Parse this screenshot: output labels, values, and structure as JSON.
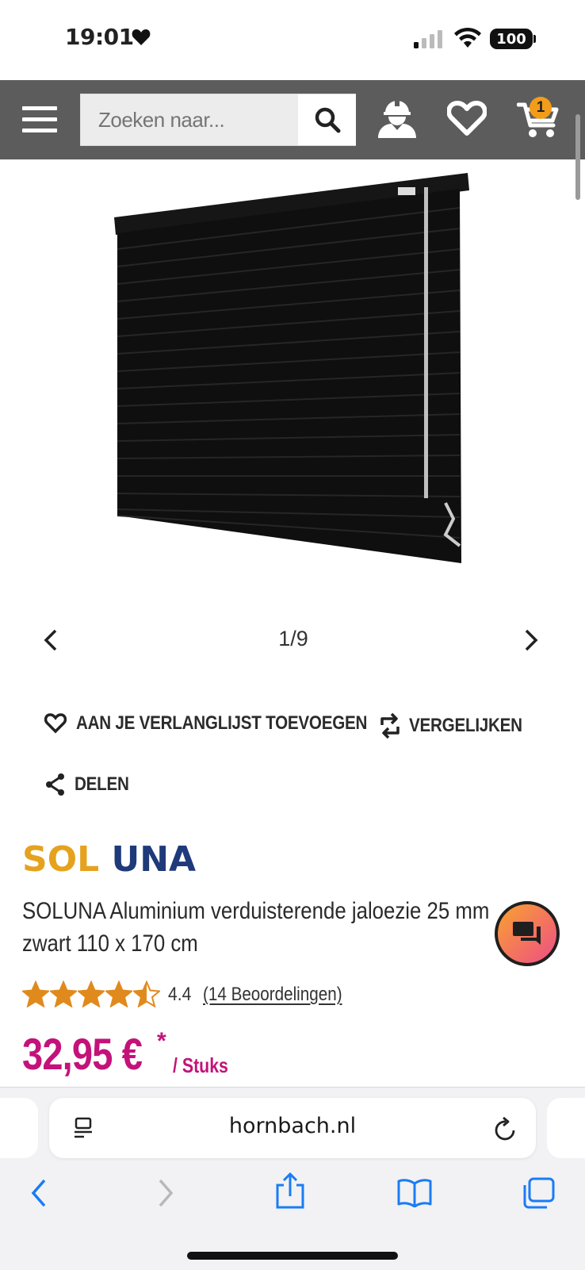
{
  "status_bar": {
    "time": "19:01",
    "battery": "100"
  },
  "header": {
    "search_placeholder": "Zoeken naar...",
    "cart_count": "1"
  },
  "gallery": {
    "counter": "1/9"
  },
  "actions": {
    "wishlist": "AAN JE VERLANGLIJST TOEVOEGEN",
    "compare": "VERGELIJKEN",
    "share": "DELEN"
  },
  "product": {
    "brand": "SOLUNA",
    "title_line1": "SOLUNA Aluminium verduisterende jaloezie 25 mm",
    "title_line2": "zwart 110 x 170 cm",
    "rating": 4.4,
    "rating_text": "4.4",
    "reviews_link": "(14 Beoordelingen)",
    "price": "32,95 €",
    "price_asterisk": "*",
    "price_unit": "/ Stuks"
  },
  "browser": {
    "url": "hornbach.nl"
  },
  "colors": {
    "header_bg": "#5c5c5c",
    "price": "#c4127a",
    "star": "#e08a1e",
    "badge": "#f39c1a",
    "ios_blue": "#1a7cf5"
  }
}
